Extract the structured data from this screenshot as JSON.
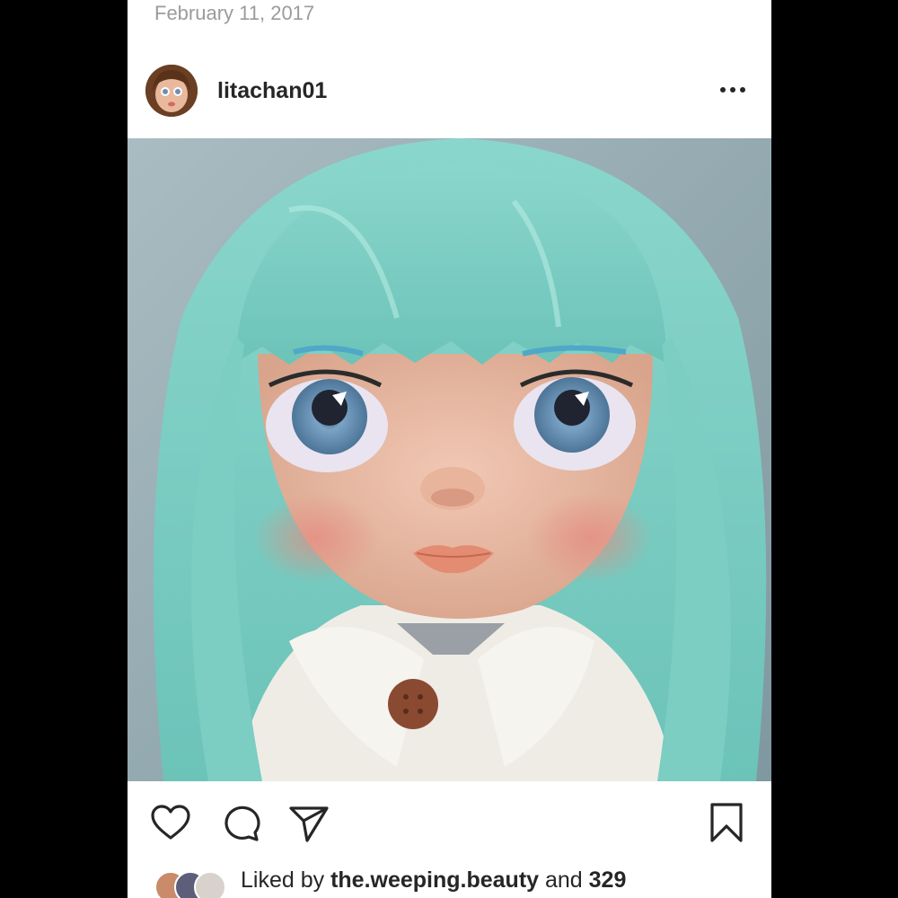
{
  "post": {
    "date": "February 11, 2017",
    "username": "litachan01",
    "liked_prefix": "Liked by ",
    "liked_user": "the.weeping.beauty",
    "liked_middle": " and ",
    "liked_count": "329"
  },
  "icons": {
    "more": "more-options-icon",
    "like": "heart-icon",
    "comment": "comment-icon",
    "share": "send-icon",
    "save": "bookmark-icon"
  },
  "colors": {
    "text": "#262626",
    "muted": "#9b9b9b",
    "hair": "#7fd0c6",
    "background": "#000000"
  }
}
